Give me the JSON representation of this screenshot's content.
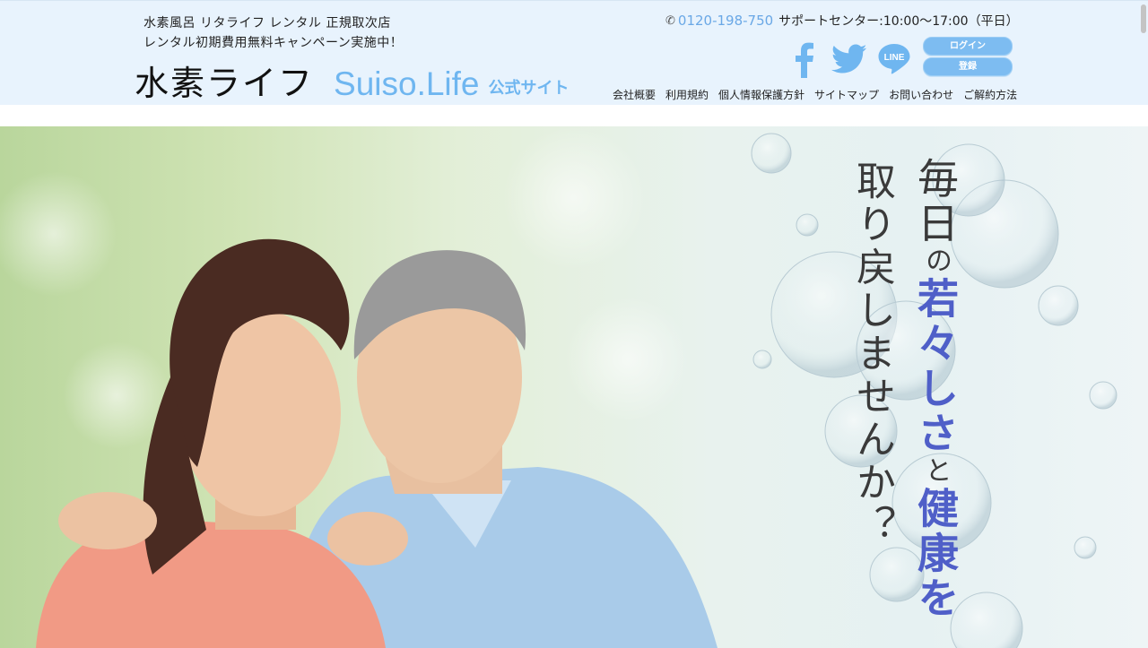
{
  "header": {
    "tagline_line1": "水素風呂 リタライフ レンタル 正規取次店",
    "tagline_line2": "レンタル初期費用無料キャンペーン実施中！",
    "logo_jp": "水素ライフ",
    "logo_en": "Suiso.Life",
    "logo_sub": "公式サイト",
    "phone": "0120-198-750",
    "support_hours": "サポートセンター:10:00〜17:00（平日）",
    "social": {
      "facebook": "f",
      "line": "LINE"
    },
    "login_label": "ログイン",
    "register_label": "登録",
    "nav": [
      "会社概要",
      "利用規約",
      "個人情報保護方針",
      "サイトマップ",
      "お問い合わせ",
      "ご解約方法"
    ]
  },
  "hero": {
    "col1": "取り戻しませんか？",
    "col2_a": "毎日",
    "col2_b": "の",
    "col2_c": "若々しさ",
    "col2_d": "と",
    "col2_e": "健康を"
  },
  "colors": {
    "accent": "#6fb6f0",
    "highlight": "#4f5fc8",
    "header_bg": "#e8f3fd"
  }
}
